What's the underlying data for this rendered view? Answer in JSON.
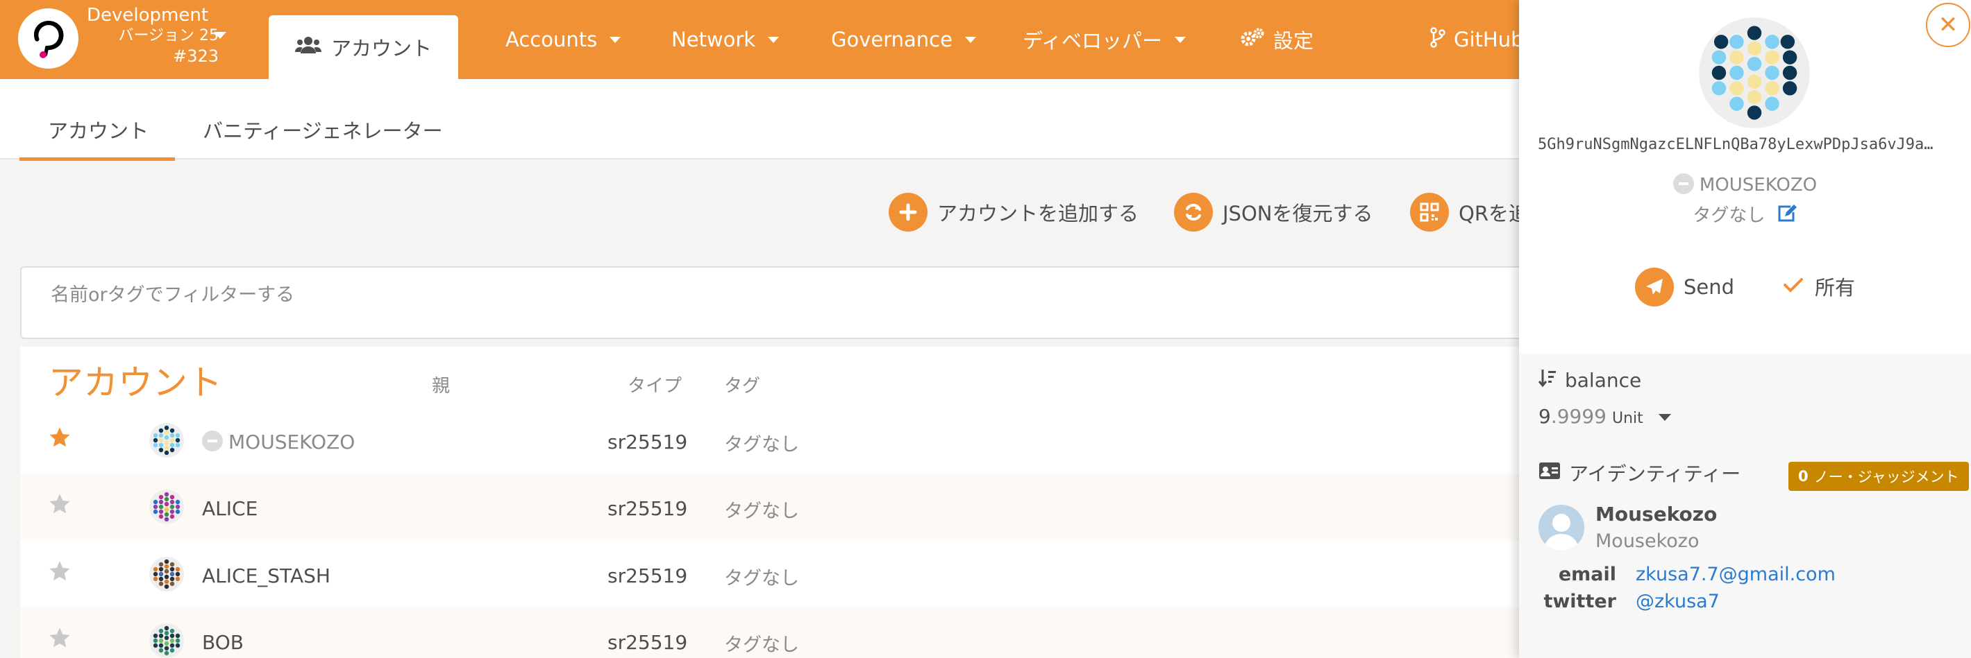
{
  "chain": {
    "name": "Development",
    "version": "バージョン 25",
    "block": "#323"
  },
  "nav": {
    "accounts_tab": "アカウント",
    "items": [
      "Accounts",
      "Network",
      "Governance",
      "ディベロッパー"
    ],
    "settings": "設定",
    "github": "GitHub"
  },
  "subnav": {
    "tabs": [
      "アカウント",
      "バニティージェネレーター"
    ]
  },
  "actions": {
    "add_account": "アカウントを追加する",
    "restore_json": "JSONを復元する",
    "qr": "QRを追"
  },
  "filter": {
    "placeholder": "名前orタグでフィルターする"
  },
  "table": {
    "title": "アカウント",
    "headers": {
      "parent": "親",
      "type": "タイプ",
      "tags": "タグ"
    },
    "rows": [
      {
        "name": "MOUSEKOZO",
        "type": "sr25519",
        "tags": "タグなし",
        "favorite": true
      },
      {
        "name": "ALICE",
        "type": "sr25519",
        "tags": "タグなし",
        "favorite": false
      },
      {
        "name": "ALICE_STASH",
        "type": "sr25519",
        "tags": "タグなし",
        "favorite": false
      },
      {
        "name": "BOB",
        "type": "sr25519",
        "tags": "タグなし",
        "favorite": false
      }
    ]
  },
  "panel": {
    "address": "5Gh9ruNSgmNgazcELNFLnQBa78yLexwPDpJsa6vJ9a…",
    "name": "MOUSEKOZO",
    "tags": "タグなし",
    "send": "Send",
    "owned": "所有",
    "balance_label": "balance",
    "balance_int": "9",
    "balance_dec": ".9999",
    "balance_unit": "Unit",
    "identity_label": "アイデンティティー",
    "judgement_count": "0",
    "judgement_label": "ノー・ジャッジメント",
    "display_name": "Mousekozo",
    "legal_name": "Mousekozo",
    "email_key": "email",
    "email": "zkusa7.7@gmail.com",
    "twitter_key": "twitter",
    "twitter": "@zkusa7"
  },
  "colors": {
    "accent": "#f19135",
    "judgement": "#c78800",
    "link": "#2a7bd0"
  }
}
